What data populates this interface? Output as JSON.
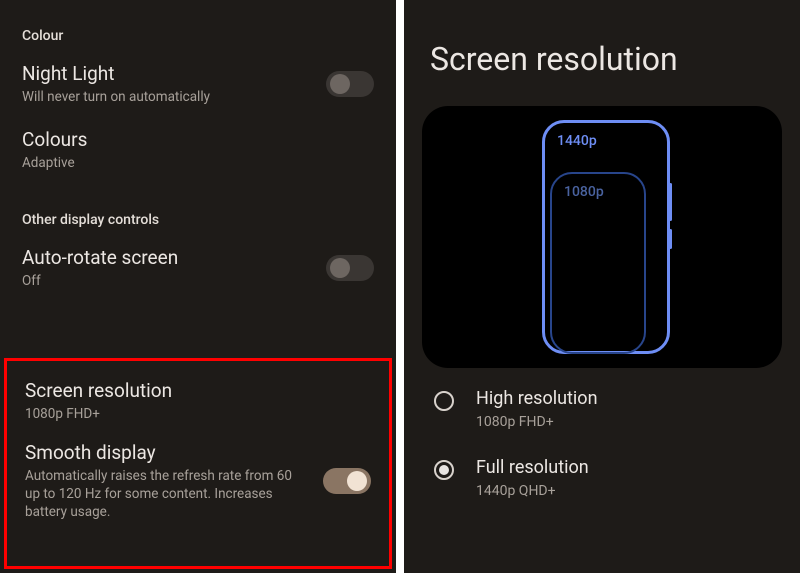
{
  "left": {
    "section_colour": "Colour",
    "night_light": {
      "title": "Night Light",
      "sub": "Will never turn on automatically",
      "on": false
    },
    "colours": {
      "title": "Colours",
      "sub": "Adaptive"
    },
    "section_other": "Other display controls",
    "auto_rotate": {
      "title": "Auto-rotate screen",
      "sub": "Off",
      "on": false
    },
    "screen_res": {
      "title": "Screen resolution",
      "sub": "1080p FHD+"
    },
    "smooth": {
      "title": "Smooth display",
      "sub": "Automatically raises the refresh rate from 60 up to 120 Hz for some content. Increases battery usage.",
      "on": true
    }
  },
  "right": {
    "heading": "Screen resolution",
    "illus": {
      "big_label": "1440p",
      "small_label": "1080p"
    },
    "options": [
      {
        "id": "high",
        "title": "High resolution",
        "sub": "1080p FHD+",
        "selected": false
      },
      {
        "id": "full",
        "title": "Full resolution",
        "sub": "1440p QHD+",
        "selected": true
      }
    ]
  }
}
